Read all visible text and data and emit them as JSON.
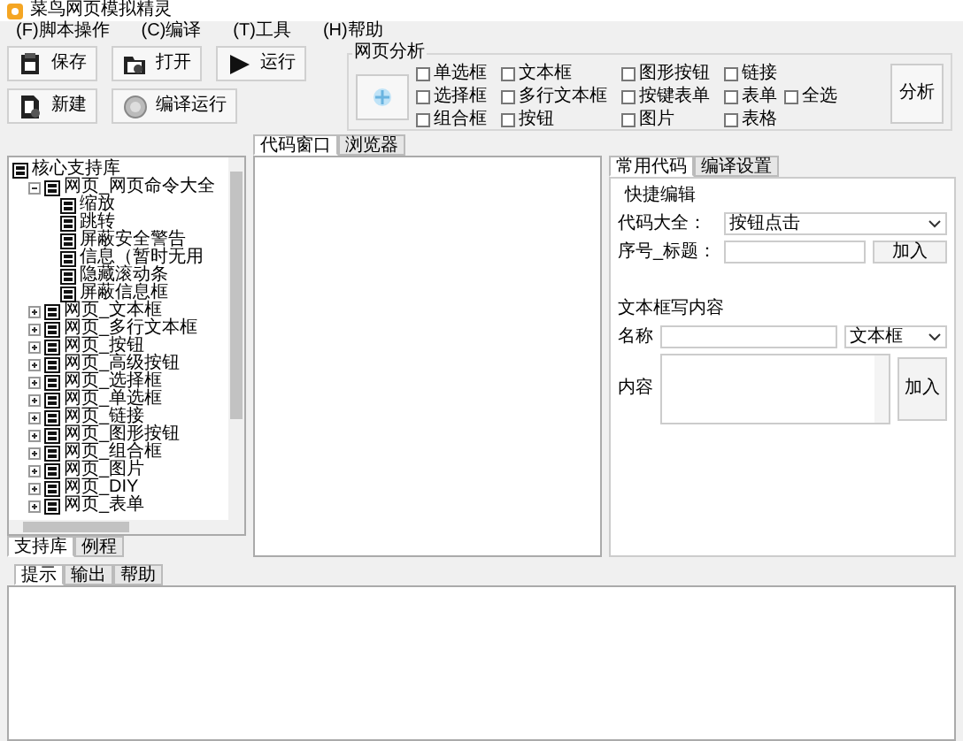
{
  "window": {
    "title": "菜鸟网页模拟精灵"
  },
  "menu": [
    "(F)脚本操作",
    "(C)编译",
    "(T)工具",
    "(H)帮助"
  ],
  "toolbar": [
    {
      "label": "保存",
      "kind": "save"
    },
    {
      "label": "打开",
      "kind": "open"
    },
    {
      "label": "运行",
      "kind": "run"
    },
    {
      "label": "新建",
      "kind": "new"
    },
    {
      "label": "编译运行",
      "kind": "compile"
    }
  ],
  "analysis": {
    "title": "网页分析",
    "checkboxes": [
      {
        "label": "单选框",
        "checked": false
      },
      {
        "label": "文本框",
        "checked": false
      },
      {
        "label": "图形按钮",
        "checked": false
      },
      {
        "label": "链接",
        "checked": false
      },
      {
        "label": "选择框",
        "checked": false
      },
      {
        "label": "多行文本框",
        "checked": false
      },
      {
        "label": "按键表单",
        "checked": false
      },
      {
        "label": "表单",
        "checked": false
      },
      {
        "label": "组合框",
        "checked": false
      },
      {
        "label": "按钮",
        "checked": false
      },
      {
        "label": "图片",
        "checked": false
      },
      {
        "label": "表格",
        "checked": false
      }
    ],
    "select_all": {
      "label": "全选",
      "checked": false
    },
    "button": "分析"
  },
  "tree": [
    {
      "label": "核心支持库",
      "children": [
        {
          "label": "网页_网页命令大全",
          "expanded": true,
          "children": [
            {
              "label": "缩放"
            },
            {
              "label": "跳转"
            },
            {
              "label": "屏蔽安全警告"
            },
            {
              "label": "信息（暂时无用"
            },
            {
              "label": "隐藏滚动条"
            },
            {
              "label": "屏蔽信息框"
            }
          ]
        },
        {
          "label": "网页_文本框",
          "expanded": false
        },
        {
          "label": "网页_多行文本框",
          "expanded": false
        },
        {
          "label": "网页_按钮",
          "expanded": false
        },
        {
          "label": "网页_高级按钮",
          "expanded": false
        },
        {
          "label": "网页_选择框",
          "expanded": false
        },
        {
          "label": "网页_单选框",
          "expanded": false
        },
        {
          "label": "网页_链接",
          "expanded": false
        },
        {
          "label": "网页_图形按钮",
          "expanded": false
        },
        {
          "label": "网页_组合框",
          "expanded": false
        },
        {
          "label": "网页_图片",
          "expanded": false
        },
        {
          "label": "网页_DIY",
          "expanded": false
        },
        {
          "label": "网页_表单",
          "expanded": false
        }
      ]
    }
  ],
  "left_tabs": [
    {
      "label": "支持库",
      "selected": true
    },
    {
      "label": "例程",
      "selected": false
    }
  ],
  "editor_tabs": [
    {
      "label": "代码窗口",
      "selected": true
    },
    {
      "label": "浏览器",
      "selected": false
    }
  ],
  "right_tabs": [
    {
      "label": "常用代码",
      "selected": true
    },
    {
      "label": "编译设置",
      "selected": false
    }
  ],
  "quick_edit": {
    "title": "快捷编辑",
    "code_label": "代码大全：",
    "code_value": "按钮点击",
    "title_label": "序号_标题：",
    "add": "加入"
  },
  "textbox_section": {
    "title": "文本框写内容",
    "name_label": "名称",
    "type_value": "文本框",
    "content_label": "内容",
    "add": "加入"
  },
  "bottom_tabs": [
    {
      "label": "提示",
      "selected": true
    },
    {
      "label": "输出",
      "selected": false
    },
    {
      "label": "帮助",
      "selected": false
    }
  ]
}
